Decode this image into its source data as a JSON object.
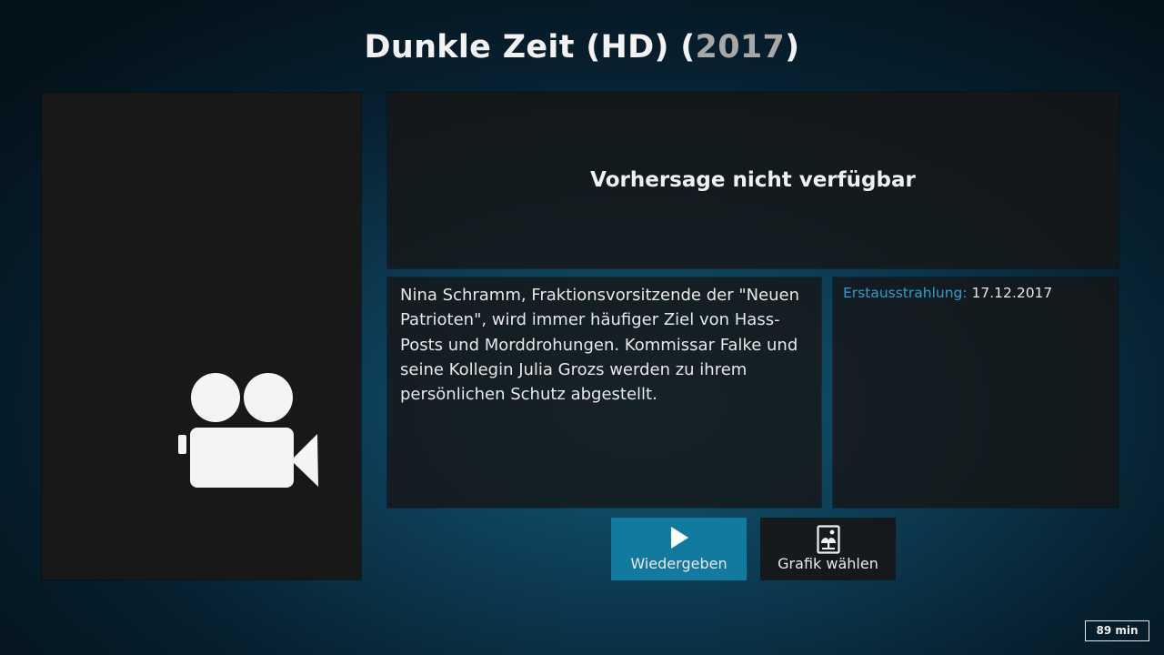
{
  "header": {
    "title_prefix": "Dunkle Zeit (HD) (",
    "year": "2017",
    "title_suffix": ")"
  },
  "poster": {
    "icon": "video-camera-icon"
  },
  "forecast": {
    "text": "Vorhersage nicht verfügbar"
  },
  "plot": {
    "text": "Nina Schramm, Fraktionsvorsitzende der \"Neuen Patrioten\", wird immer häufiger Ziel von Hass-Posts und Morddrohungen. Kommissar Falke und seine Kollegin Julia Grozs werden zu ihrem persönlichen Schutz abgestellt."
  },
  "info": {
    "premiere_label": "Erstausstrahlung:",
    "premiere_value": "17.12.2017"
  },
  "buttons": {
    "play_label": "Wiedergeben",
    "play_icon": "play-icon",
    "art_label": "Grafik wählen",
    "art_icon": "picture-icon"
  },
  "duration": {
    "text": "89 min"
  },
  "colors": {
    "accent": "#12799f",
    "label_blue": "#2a9ed6"
  }
}
